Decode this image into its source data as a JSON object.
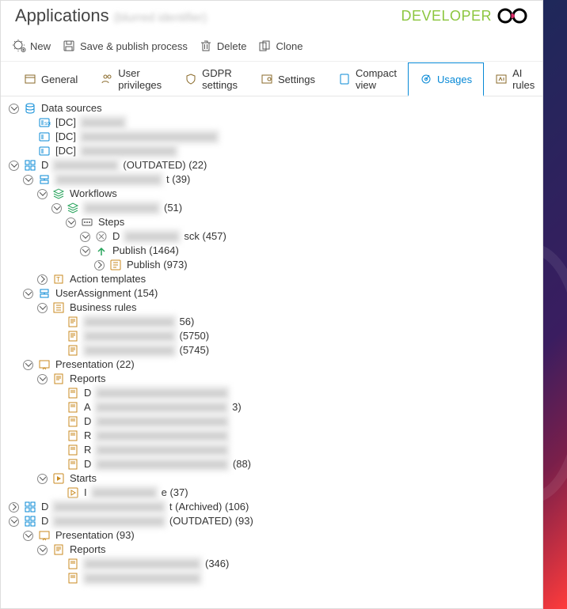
{
  "header": {
    "title": "Applications",
    "subtitle": "(blurred identifier)"
  },
  "brand": {
    "word": "DEVELOPER"
  },
  "toolbar": {
    "new": "New",
    "save_publish": "Save & publish process",
    "delete": "Delete",
    "clone": "Clone"
  },
  "tabs": {
    "general": "General",
    "user_privileges": "User privileges",
    "gdpr": "GDPR settings",
    "settings": "Settings",
    "compact": "Compact view",
    "usages": "Usages",
    "ai_rules": "AI rules"
  },
  "tree": {
    "data_sources": "Data sources",
    "ds_item1_prefix": "[DC]",
    "ds_item2_prefix": "[DC]",
    "ds_item3_prefix": "[DC]",
    "group1_suffix": "(OUTDATED) (22)",
    "group1_child_suffix": "t (39)",
    "workflows": "Workflows",
    "wf_item1_suffix": "(51)",
    "steps": "Steps",
    "steps_item1_prefix": "D",
    "steps_item1_suffix": "sck (457)",
    "publish_a": "Publish (1464)",
    "publish_b": "Publish (973)",
    "action_templates": "Action templates",
    "user_assignment": "UserAssignment (154)",
    "business_rules": "Business rules",
    "br_item1_suffix": "56)",
    "br_item2_suffix": "(5750)",
    "br_item3_suffix": "(5745)",
    "presentation1": "Presentation (22)",
    "reports1": "Reports",
    "r1_a": "D",
    "r1_b": "A",
    "r1_b_suffix": "3)",
    "r1_c": "D",
    "r1_d": "R",
    "r1_e": "R",
    "r1_f": "D",
    "r1_f_suffix": "(88)",
    "starts": "Starts",
    "starts_item_suffix": "e (37)",
    "archived_suffix": "t (Archived) (106)",
    "outdated_suffix": "(OUTDATED) (93)",
    "presentation2": "Presentation (93)",
    "reports2": "Reports",
    "reports2_item_suffix": "(346)"
  }
}
